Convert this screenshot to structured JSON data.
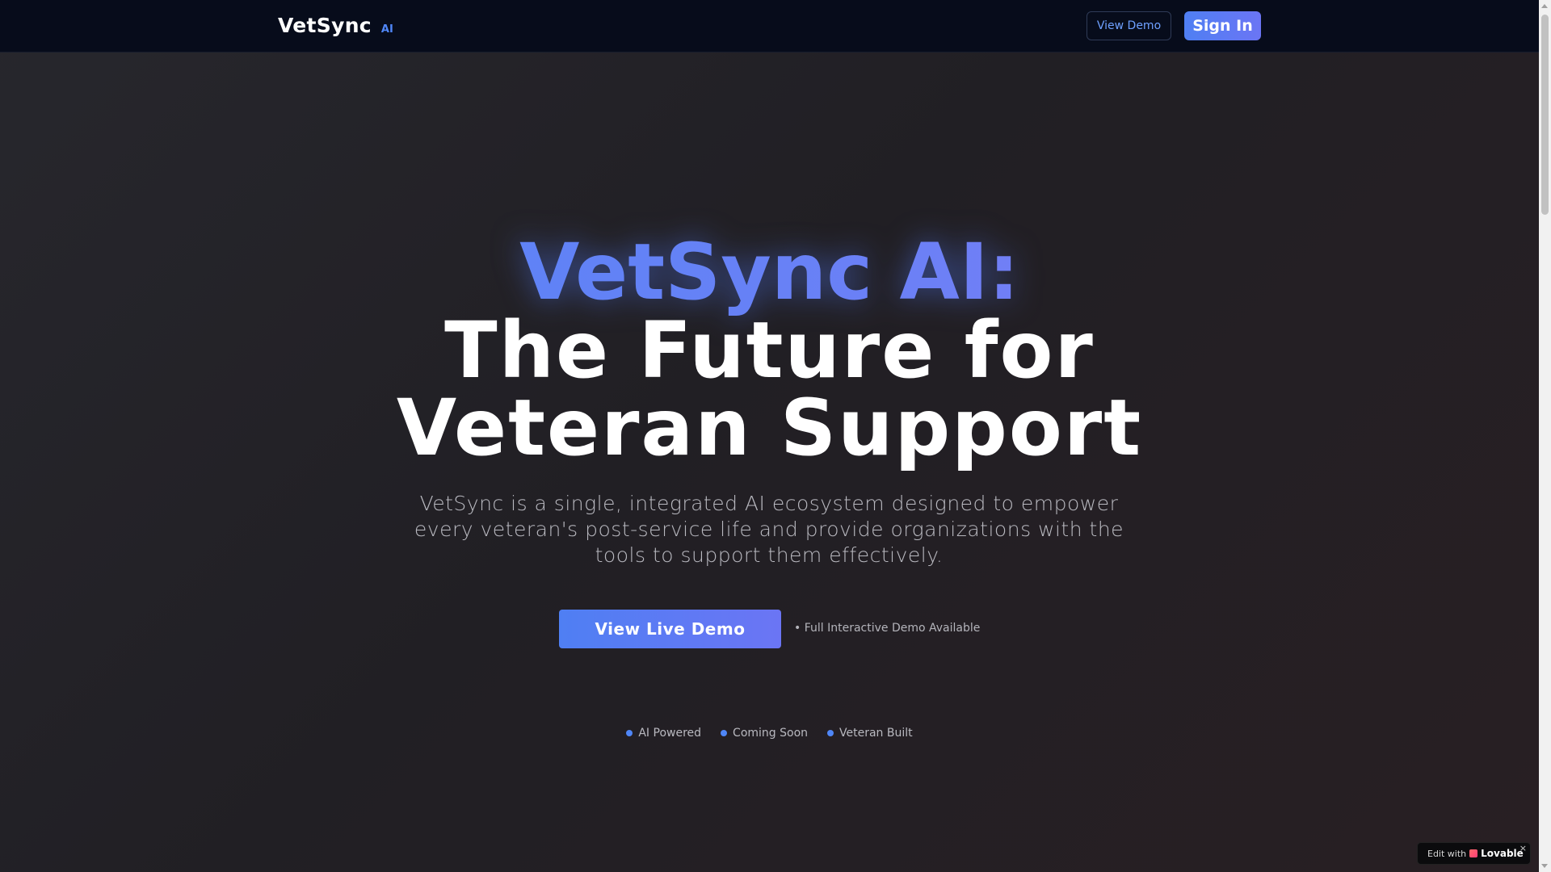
{
  "navbar": {
    "brand_name": "VetSync",
    "brand_badge": "AI",
    "view_demo_label": "View Demo",
    "sign_in_label": "Sign In"
  },
  "hero": {
    "title_line1": "VetSync AI:",
    "title_line2": "The Future for",
    "title_line3": "Veteran Support",
    "subtitle": "VetSync is a single, integrated AI ecosystem designed to empower every veteran's post-service life and provide organizations with the tools to support them effectively.",
    "cta_label": "View Live Demo",
    "cta_note": "• Full Interactive Demo Available"
  },
  "features": [
    {
      "label": "AI Powered"
    },
    {
      "label": "Coming Soon"
    },
    {
      "label": "Veteran Built"
    }
  ],
  "lovable_badge": {
    "prefix": "Edit with",
    "brand": "Lovable",
    "close": "×"
  },
  "colors": {
    "accent": "#4f86f7",
    "accent_purple": "#6b75f4",
    "navbar_bg": "#070c1b"
  },
  "icons": {
    "feature_dot": "dot-icon",
    "lovable": "lovable-heart-icon",
    "close": "close-icon"
  }
}
